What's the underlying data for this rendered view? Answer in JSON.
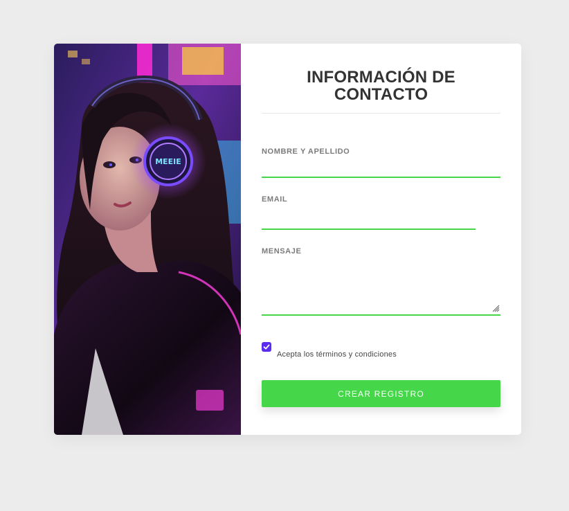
{
  "form": {
    "title": "INFORMACIÓN DE CONTACTO",
    "fields": {
      "name": {
        "label": "NOMBRE Y APELLIDO",
        "value": ""
      },
      "email": {
        "label": "EMAIL",
        "value": ""
      },
      "message": {
        "label": "MENSAJE",
        "value": ""
      }
    },
    "terms": {
      "label": "Acepta los términos y condiciones",
      "checked": true
    },
    "submit_label": "CREAR REGISTRO"
  },
  "hero": {
    "badge_text": "MEEIE"
  },
  "colors": {
    "accent": "#45d64a",
    "checkbox": "#5b2cf0",
    "page_bg": "#ececec",
    "title": "#333333"
  },
  "icons": [
    "check-icon",
    "resize-grip-icon"
  ]
}
